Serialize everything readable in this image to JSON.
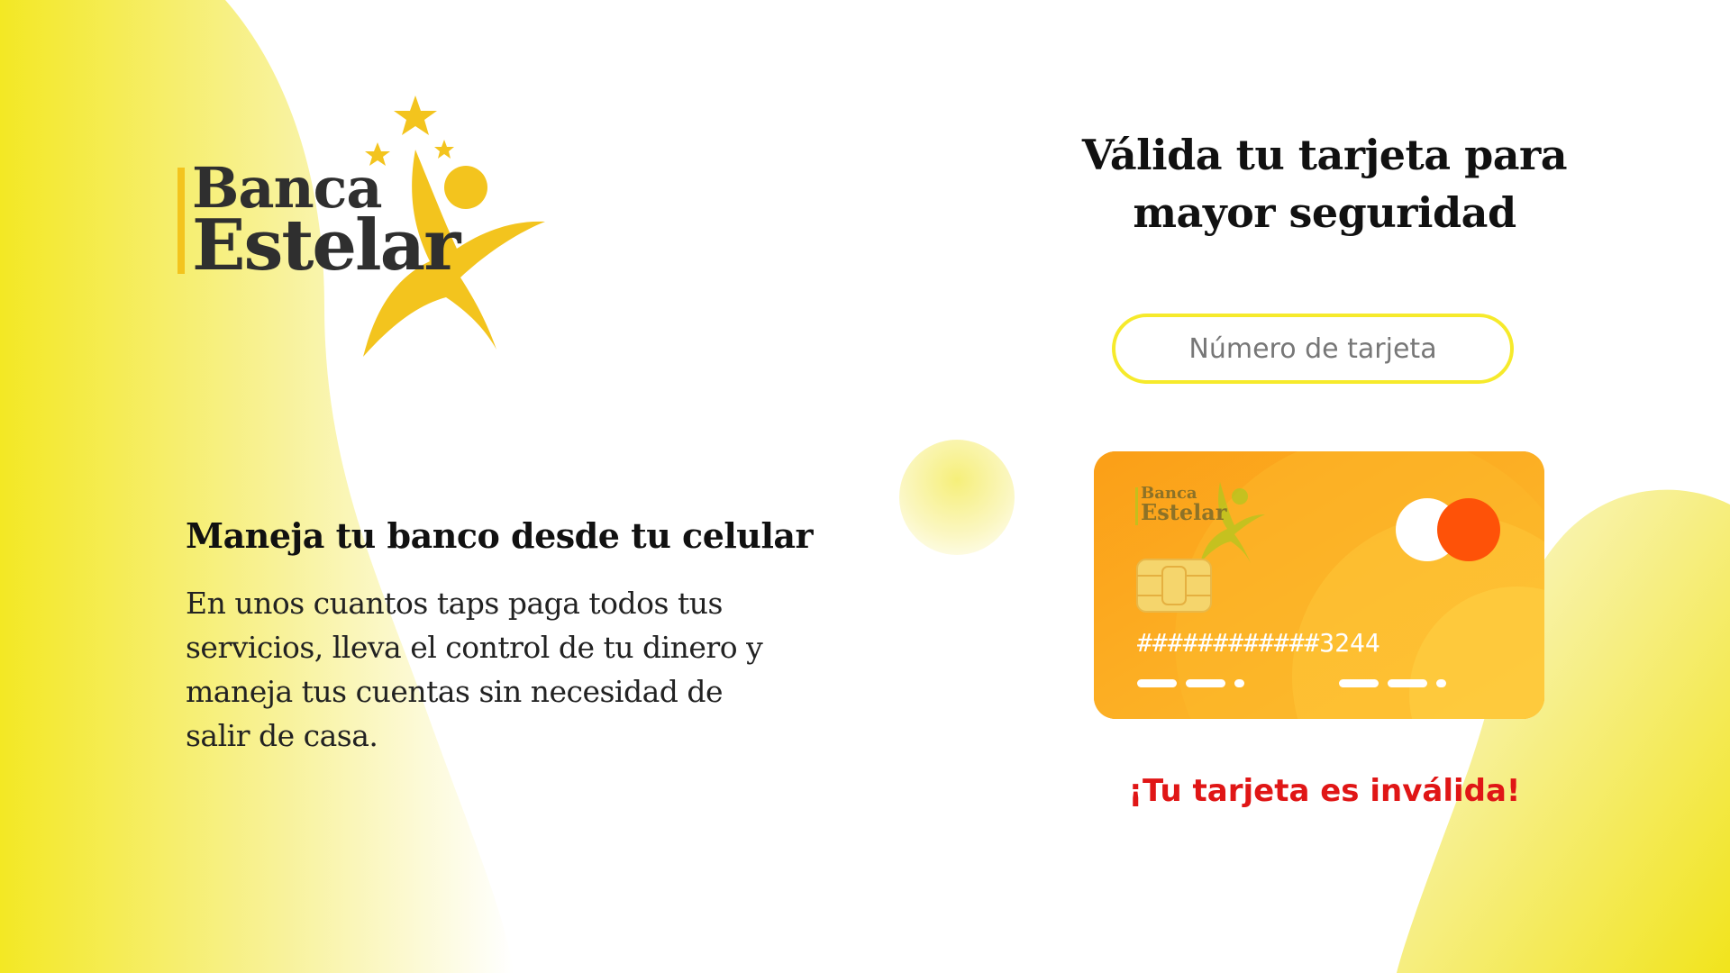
{
  "brand": {
    "line1": "Banca",
    "line2": "Estelar"
  },
  "promo": {
    "title": "Maneja tu banco desde tu celular",
    "text": "En unos cuantos taps paga todos tus servicios, lleva el control de tu dinero y maneja tus cuentas sin necesidad de salir de casa."
  },
  "validation": {
    "heading": "Válida tu tarjeta para mayor seguridad",
    "input_value": "",
    "input_placeholder": "Número de tarjeta",
    "error_message": "¡Tu tarjeta es inválida!"
  },
  "card": {
    "number": "############3244",
    "brand_line1": "Banca",
    "brand_line2": "Estelar",
    "chip_icon": "chip-icon",
    "network_icon": "mastercard-icon"
  },
  "colors": {
    "accent_yellow": "#f3c41e",
    "input_border": "#f6ea2b",
    "card_orange": "#f9a51d",
    "error_red": "#e01616",
    "blob_yellow": "#f4ea36"
  }
}
